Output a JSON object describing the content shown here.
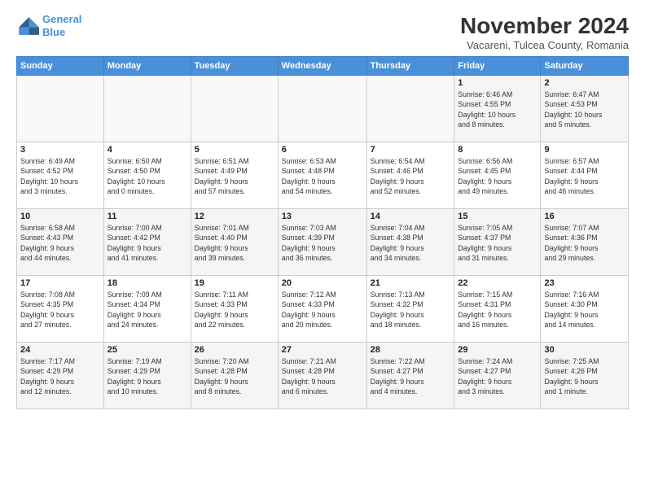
{
  "header": {
    "logo_line1": "General",
    "logo_line2": "Blue",
    "title": "November 2024",
    "subtitle": "Vacareni, Tulcea County, Romania"
  },
  "days_of_week": [
    "Sunday",
    "Monday",
    "Tuesday",
    "Wednesday",
    "Thursday",
    "Friday",
    "Saturday"
  ],
  "weeks": [
    [
      {
        "day": "",
        "detail": ""
      },
      {
        "day": "",
        "detail": ""
      },
      {
        "day": "",
        "detail": ""
      },
      {
        "day": "",
        "detail": ""
      },
      {
        "day": "",
        "detail": ""
      },
      {
        "day": "1",
        "detail": "Sunrise: 6:46 AM\nSunset: 4:55 PM\nDaylight: 10 hours\nand 8 minutes."
      },
      {
        "day": "2",
        "detail": "Sunrise: 6:47 AM\nSunset: 4:53 PM\nDaylight: 10 hours\nand 5 minutes."
      }
    ],
    [
      {
        "day": "3",
        "detail": "Sunrise: 6:49 AM\nSunset: 4:52 PM\nDaylight: 10 hours\nand 3 minutes."
      },
      {
        "day": "4",
        "detail": "Sunrise: 6:50 AM\nSunset: 4:50 PM\nDaylight: 10 hours\nand 0 minutes."
      },
      {
        "day": "5",
        "detail": "Sunrise: 6:51 AM\nSunset: 4:49 PM\nDaylight: 9 hours\nand 57 minutes."
      },
      {
        "day": "6",
        "detail": "Sunrise: 6:53 AM\nSunset: 4:48 PM\nDaylight: 9 hours\nand 54 minutes."
      },
      {
        "day": "7",
        "detail": "Sunrise: 6:54 AM\nSunset: 4:46 PM\nDaylight: 9 hours\nand 52 minutes."
      },
      {
        "day": "8",
        "detail": "Sunrise: 6:56 AM\nSunset: 4:45 PM\nDaylight: 9 hours\nand 49 minutes."
      },
      {
        "day": "9",
        "detail": "Sunrise: 6:57 AM\nSunset: 4:44 PM\nDaylight: 9 hours\nand 46 minutes."
      }
    ],
    [
      {
        "day": "10",
        "detail": "Sunrise: 6:58 AM\nSunset: 4:43 PM\nDaylight: 9 hours\nand 44 minutes."
      },
      {
        "day": "11",
        "detail": "Sunrise: 7:00 AM\nSunset: 4:42 PM\nDaylight: 9 hours\nand 41 minutes."
      },
      {
        "day": "12",
        "detail": "Sunrise: 7:01 AM\nSunset: 4:40 PM\nDaylight: 9 hours\nand 39 minutes."
      },
      {
        "day": "13",
        "detail": "Sunrise: 7:03 AM\nSunset: 4:39 PM\nDaylight: 9 hours\nand 36 minutes."
      },
      {
        "day": "14",
        "detail": "Sunrise: 7:04 AM\nSunset: 4:38 PM\nDaylight: 9 hours\nand 34 minutes."
      },
      {
        "day": "15",
        "detail": "Sunrise: 7:05 AM\nSunset: 4:37 PM\nDaylight: 9 hours\nand 31 minutes."
      },
      {
        "day": "16",
        "detail": "Sunrise: 7:07 AM\nSunset: 4:36 PM\nDaylight: 9 hours\nand 29 minutes."
      }
    ],
    [
      {
        "day": "17",
        "detail": "Sunrise: 7:08 AM\nSunset: 4:35 PM\nDaylight: 9 hours\nand 27 minutes."
      },
      {
        "day": "18",
        "detail": "Sunrise: 7:09 AM\nSunset: 4:34 PM\nDaylight: 9 hours\nand 24 minutes."
      },
      {
        "day": "19",
        "detail": "Sunrise: 7:11 AM\nSunset: 4:33 PM\nDaylight: 9 hours\nand 22 minutes."
      },
      {
        "day": "20",
        "detail": "Sunrise: 7:12 AM\nSunset: 4:33 PM\nDaylight: 9 hours\nand 20 minutes."
      },
      {
        "day": "21",
        "detail": "Sunrise: 7:13 AM\nSunset: 4:32 PM\nDaylight: 9 hours\nand 18 minutes."
      },
      {
        "day": "22",
        "detail": "Sunrise: 7:15 AM\nSunset: 4:31 PM\nDaylight: 9 hours\nand 16 minutes."
      },
      {
        "day": "23",
        "detail": "Sunrise: 7:16 AM\nSunset: 4:30 PM\nDaylight: 9 hours\nand 14 minutes."
      }
    ],
    [
      {
        "day": "24",
        "detail": "Sunrise: 7:17 AM\nSunset: 4:29 PM\nDaylight: 9 hours\nand 12 minutes."
      },
      {
        "day": "25",
        "detail": "Sunrise: 7:19 AM\nSunset: 4:29 PM\nDaylight: 9 hours\nand 10 minutes."
      },
      {
        "day": "26",
        "detail": "Sunrise: 7:20 AM\nSunset: 4:28 PM\nDaylight: 9 hours\nand 8 minutes."
      },
      {
        "day": "27",
        "detail": "Sunrise: 7:21 AM\nSunset: 4:28 PM\nDaylight: 9 hours\nand 6 minutes."
      },
      {
        "day": "28",
        "detail": "Sunrise: 7:22 AM\nSunset: 4:27 PM\nDaylight: 9 hours\nand 4 minutes."
      },
      {
        "day": "29",
        "detail": "Sunrise: 7:24 AM\nSunset: 4:27 PM\nDaylight: 9 hours\nand 3 minutes."
      },
      {
        "day": "30",
        "detail": "Sunrise: 7:25 AM\nSunset: 4:26 PM\nDaylight: 9 hours\nand 1 minute."
      }
    ]
  ]
}
